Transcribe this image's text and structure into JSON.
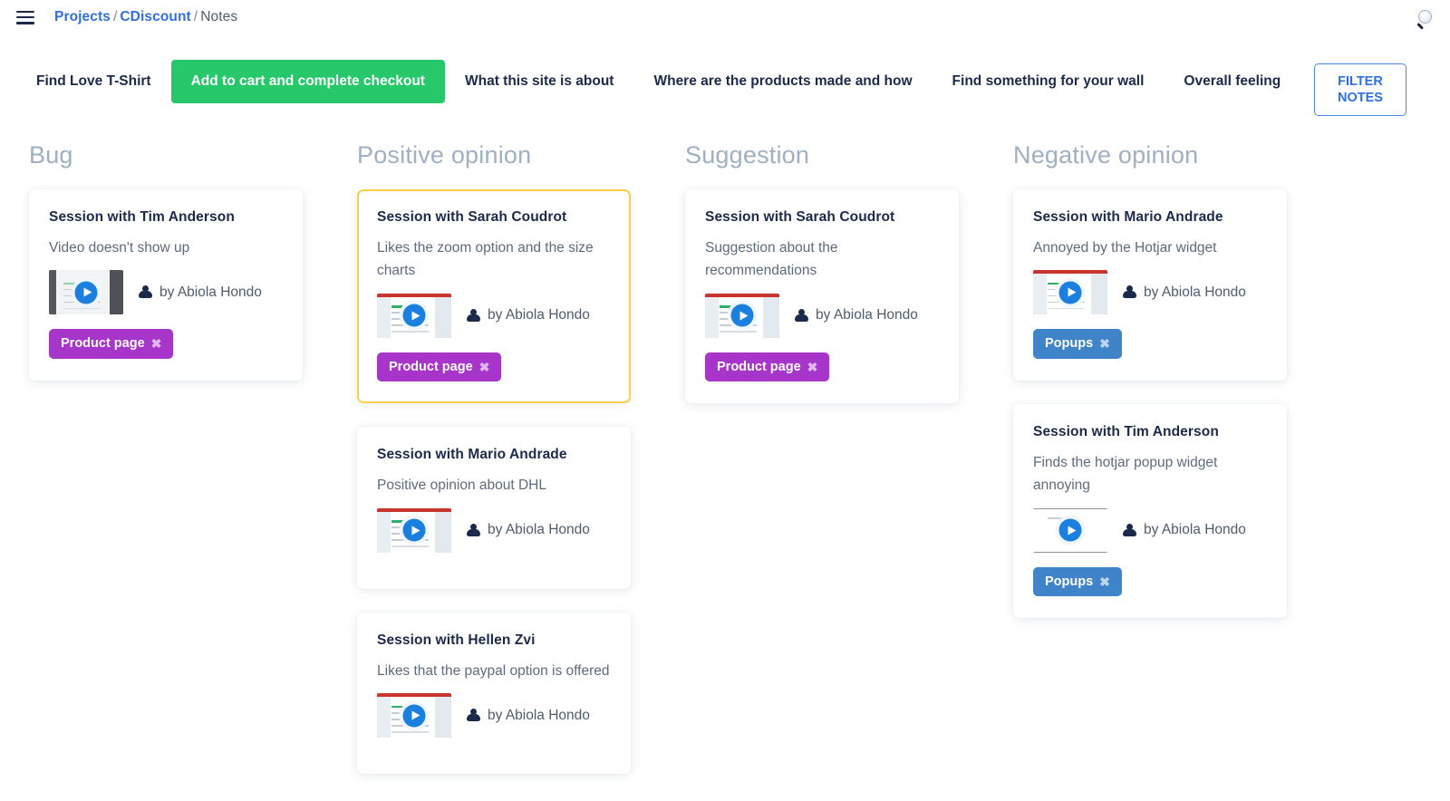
{
  "topbar": {
    "menu_icon": "hamburger-menu-icon",
    "breadcrumb": {
      "projects": "Projects",
      "sep1": "/",
      "project_name": "CDiscount",
      "sep2": "/",
      "current": "Notes"
    },
    "search_icon": "search-icon"
  },
  "tabs": [
    {
      "label": "Find Love T-Shirt",
      "active": false
    },
    {
      "label": "Add to cart and complete checkout",
      "active": true
    },
    {
      "label": "What this site is about",
      "active": false
    },
    {
      "label": "Where are the products made and how",
      "active": false
    },
    {
      "label": "Find something for your wall",
      "active": false
    },
    {
      "label": "Overall feeling",
      "active": false
    }
  ],
  "filter_button": {
    "line1": "FILTER",
    "line2": "NOTES"
  },
  "colors": {
    "accent_green": "#26c86a",
    "link_blue": "#2f6fe4",
    "tag_purple": "#a735c9",
    "tag_blue": "#3f84c9",
    "selected_border": "#f5d24a",
    "column_title": "#9fb0c2",
    "play_blue": "#1b7fe0"
  },
  "columns": [
    {
      "title": "Bug",
      "cards": [
        {
          "title": "Session with Tim Anderson",
          "description": "Video doesn't show up",
          "author": "by Abiola Hondo",
          "thumb_style": "dark",
          "tag": {
            "label": "Product page",
            "close": "✖",
            "color": "purple"
          },
          "selected": false
        }
      ]
    },
    {
      "title": "Positive opinion",
      "cards": [
        {
          "title": "Session with Sarah Coudrot",
          "description": "Likes the zoom option and the size charts",
          "author": "by Abiola Hondo",
          "thumb_style": "light",
          "tag": {
            "label": "Product page",
            "close": "✖",
            "color": "purple"
          },
          "selected": true
        },
        {
          "title": "Session with Mario Andrade",
          "description": "Positive opinion about DHL",
          "author": "by Abiola Hondo",
          "thumb_style": "light",
          "tag": null,
          "selected": false
        },
        {
          "title": "Session with Hellen Zvi",
          "description": "Likes that the paypal option is offered",
          "author": "by Abiola Hondo",
          "thumb_style": "light",
          "tag": null,
          "selected": false
        }
      ]
    },
    {
      "title": "Suggestion",
      "cards": [
        {
          "title": "Session with Sarah Coudrot",
          "description": "Suggestion about the recommendations",
          "author": "by Abiola Hondo",
          "thumb_style": "light",
          "tag": {
            "label": "Product page",
            "close": "✖",
            "color": "purple"
          },
          "selected": false
        }
      ]
    },
    {
      "title": "Negative opinion",
      "cards": [
        {
          "title": "Session with Mario Andrade",
          "description": "Annoyed by the Hotjar widget",
          "author": "by Abiola Hondo",
          "thumb_style": "light",
          "tag": {
            "label": "Popups",
            "close": "✖",
            "color": "blue"
          },
          "selected": false
        },
        {
          "title": "Session with Tim Anderson",
          "description": "Finds the hotjar popup widget annoying",
          "author": "by Abiola Hondo",
          "thumb_style": "blank",
          "tag": {
            "label": "Popups",
            "close": "✖",
            "color": "blue"
          },
          "selected": false
        }
      ]
    }
  ]
}
